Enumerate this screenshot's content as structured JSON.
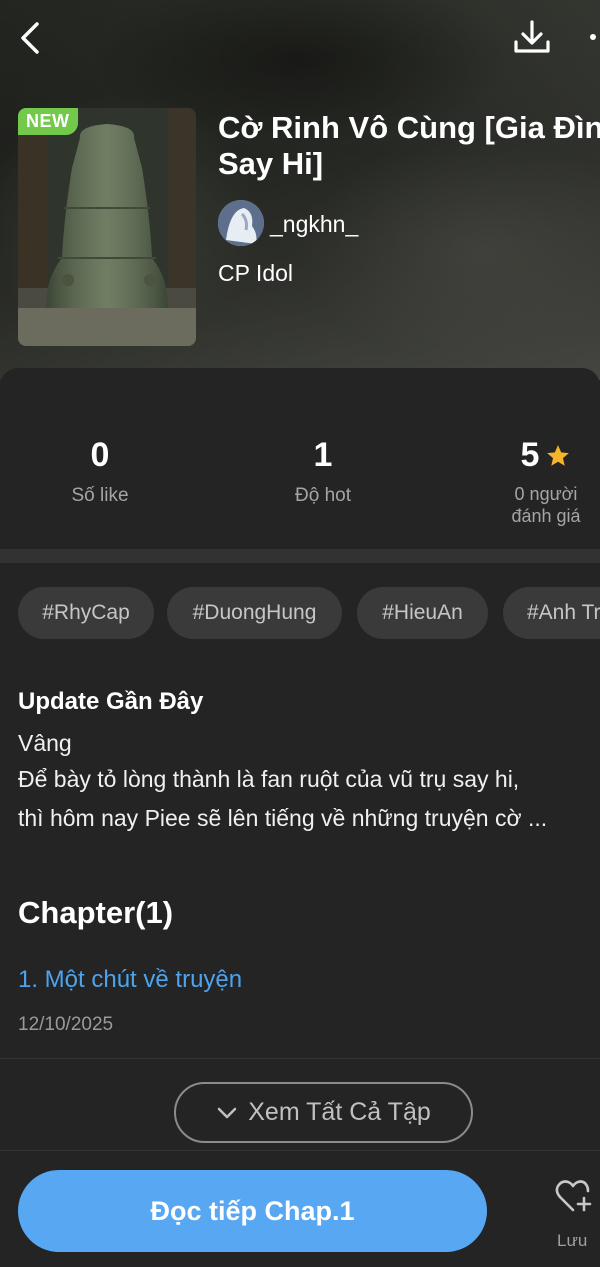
{
  "colors": {
    "accent": "#58a7f2",
    "link": "#4da3ee",
    "badge_new": "#73c94a",
    "star": "#f5b52a",
    "background": "#242424"
  },
  "header": {
    "back_icon": "chevron-left-icon",
    "download_icon": "download-icon",
    "more_icon": "more-vertical-icon"
  },
  "book": {
    "badge": "NEW",
    "title_line1": "Cờ Rinh Vô Cùng [Gia Đình",
    "title_line2": "Say Hi]",
    "author": "_ngkhn_",
    "category": "CP Idol"
  },
  "stats": [
    {
      "value": "0",
      "label": "Số like"
    },
    {
      "value": "1",
      "label": "Độ hot"
    },
    {
      "value": "5",
      "label_line1": "0 người",
      "label_line2": "đánh giá"
    }
  ],
  "tags": [
    "#RhyCap",
    "#DuongHung",
    "#HieuAn",
    "#Anh Tr"
  ],
  "update": {
    "title": "Update Gần Đây",
    "line1": "Vâng",
    "line2": "Để bày tỏ lòng thành là fan ruột của vũ trụ say hi,",
    "line3": "thì hôm nay Piee sẽ lên tiếng về những truyện cờ ..."
  },
  "chapters": {
    "heading": "Chapter(1)",
    "items": [
      {
        "title": "1. Một chút về truyện",
        "date": "12/10/2025"
      }
    ],
    "see_all": "Xem Tất Cả Tập"
  },
  "bottom": {
    "read_button": "Đọc tiếp Chap.1",
    "save_label": "Lưu"
  }
}
